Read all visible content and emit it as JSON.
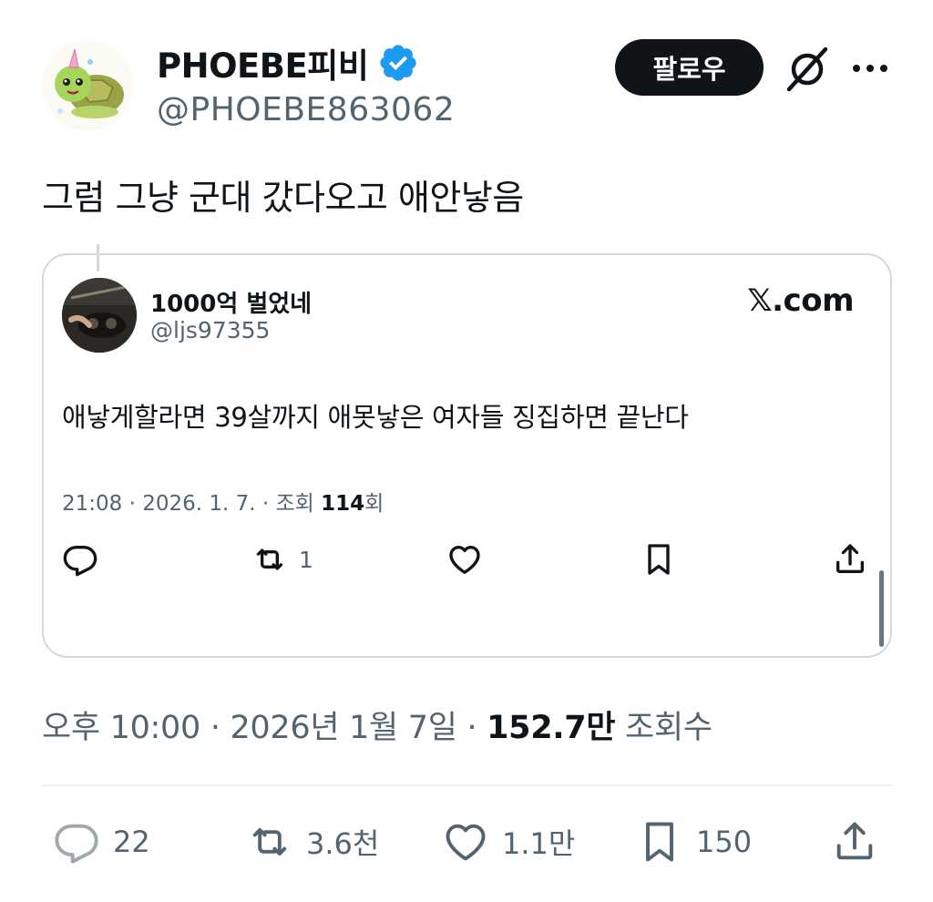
{
  "author": {
    "display_name": "PHOEBE피비",
    "handle": "@PHOEBE863062",
    "avatar_icon": "turtle-unicorn-avatar"
  },
  "header": {
    "follow_label": "팔로우",
    "grok_icon": "grok-icon",
    "more_icon": "more-icon"
  },
  "tweet": {
    "text": "그럼 그냥 군대 갔다오고 애안낳음"
  },
  "quote": {
    "display_name": "1000억 벌었네",
    "handle": "@ljs97355",
    "site": "𝕏.com",
    "text": "애낳게할라면 39살까지 애못낳은 여자들 징집하면 끝난다",
    "meta_prefix": "21:08 · 2026. 1. 7. · 조회 ",
    "views": "114",
    "meta_suffix": "회",
    "actions": {
      "reply_count": "",
      "retweet_count": "1",
      "like_count": "",
      "bookmark_count": ""
    }
  },
  "timestamp": {
    "prefix": "오후 10:00 · 2026년 1월 7일 · ",
    "views": "152.7만",
    "suffix": " 조회수"
  },
  "actions": {
    "reply_count": "22",
    "retweet_count": "3.6천",
    "like_count": "1.1만",
    "bookmark_count": "150"
  },
  "colors": {
    "text_primary": "#0f1419",
    "text_secondary": "#536471",
    "verified_blue": "#1d9bf0",
    "border": "#cfd9de"
  }
}
